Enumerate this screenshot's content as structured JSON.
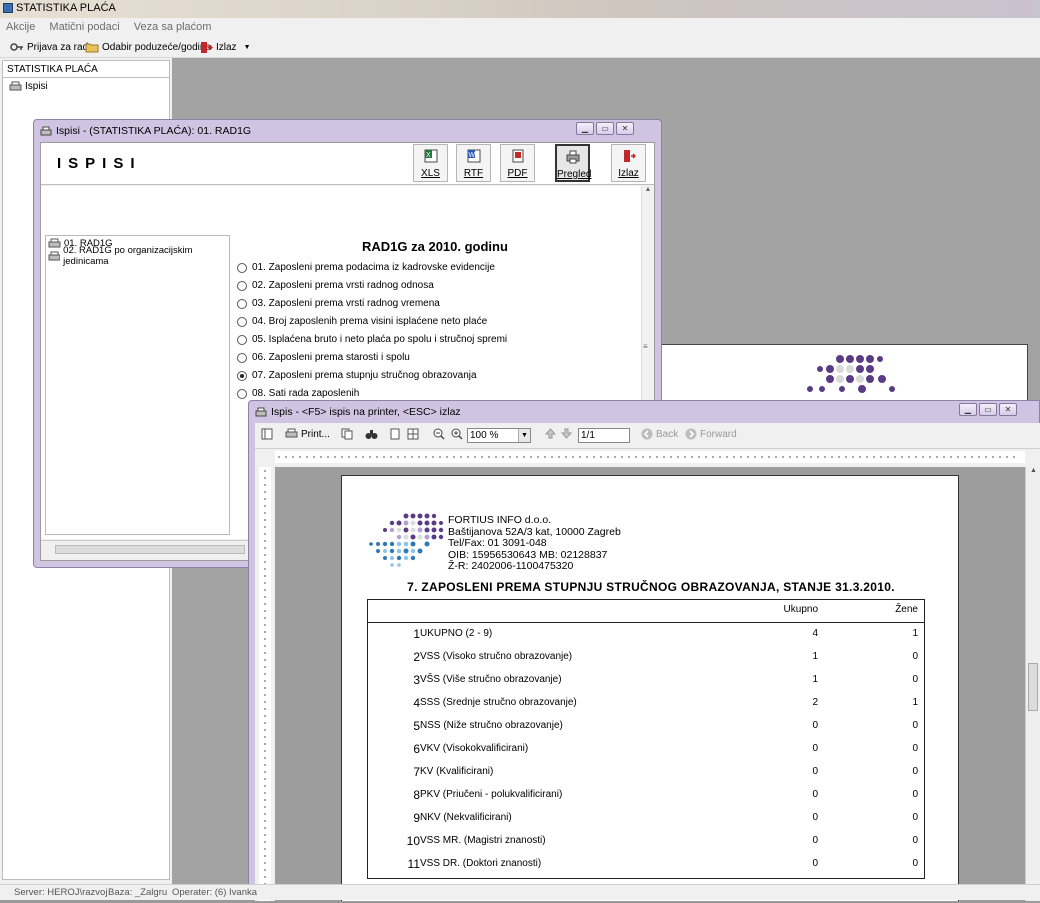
{
  "app": {
    "title": "STATISTIKA PLAĆA",
    "menu": [
      "Akcije",
      "Matični podaci",
      "Veza sa plaćom"
    ],
    "toolbar": {
      "login": "Prijava za rad",
      "company": "Odabir poduzeće/godina",
      "exit": "Izlaz"
    }
  },
  "left_panel": {
    "header": "STATISTIKA PLAĆA",
    "item": "Ispisi"
  },
  "statusbar": {
    "server": "Server: HEROJ\\razvoj",
    "baza": "Baza: _Zalgru",
    "operater": "Operater: (6) Ivanka"
  },
  "ispisi_window": {
    "title": "Ispisi - (STATISTIKA PLAĆA): 01. RAD1G",
    "heading": "ISPISI",
    "buttons": [
      "XLS",
      "RTF",
      "PDF",
      "Pregled",
      "Izlaz"
    ],
    "reports": [
      "01. RAD1G",
      "02. RAD1G po organizacijskim jedinicama"
    ],
    "section_title": "RAD1G za 2010. godinu",
    "options": [
      "01. Zaposleni prema podacima iz kadrovske evidencije",
      "02. Zaposleni prema vrsti radnog odnosa",
      "03. Zaposleni prema vrsti radnog vremena",
      "04. Broj zaposlenih prema visini isplaćene neto plaće",
      "05. Isplaćena bruto i neto plaća po spolu i stručnoj spremi",
      "06. Zaposleni prema starosti i spolu",
      "07. Zaposleni prema stupnju stručnog obrazovanja",
      "08. Sati rada zaposlenih"
    ],
    "selected_option_index": 6
  },
  "preview_window": {
    "title": "Ispis - <F5> ispis na printer, <ESC> izlaz",
    "print_label": "Print...",
    "zoom": "100 %",
    "page": "1/1",
    "back": "Back",
    "forward": "Forward",
    "company": {
      "name": "FORTIUS INFO d.o.o.",
      "address": "Baštijanova 52A/3 kat, 10000 Zagreb",
      "telfax": "Tel/Fax: 01 3091-048",
      "oib": "OIB: 15956530643  MB: 02128837",
      "zr": "Ž-R: 2402006-1100475320"
    },
    "report_title": "7. ZAPOSLENI PREMA STUPNJU STRUČNOG OBRAZOVANJA, STANJE 31.3.2010.",
    "table": {
      "col_ukupno": "Ukupno",
      "col_zene": "Žene",
      "rows": [
        {
          "num": "1",
          "name": "UKUPNO (2 - 9)",
          "ukupno": "4",
          "zene": "1"
        },
        {
          "num": "2",
          "name": "VSS (Visoko stručno obrazovanje)",
          "ukupno": "1",
          "zene": "0"
        },
        {
          "num": "3",
          "name": "VŠS (Više stručno obrazovanje)",
          "ukupno": "1",
          "zene": "0"
        },
        {
          "num": "4",
          "name": "SSS (Srednje stručno obrazovanje)",
          "ukupno": "2",
          "zene": "1"
        },
        {
          "num": "5",
          "name": "NSS (Niže stručno obrazovanje)",
          "ukupno": "0",
          "zene": "0"
        },
        {
          "num": "6",
          "name": "VKV (Visokokvalificirani)",
          "ukupno": "0",
          "zene": "0"
        },
        {
          "num": "7",
          "name": "KV (Kvalificirani)",
          "ukupno": "0",
          "zene": "0"
        },
        {
          "num": "8",
          "name": "PKV (Priučeni - polukvalificirani)",
          "ukupno": "0",
          "zene": "0"
        },
        {
          "num": "9",
          "name": "NKV (Nekvalificirani)",
          "ukupno": "0",
          "zene": "0"
        },
        {
          "num": "10",
          "name": "VSS MR. (Magistri znanosti)",
          "ukupno": "0",
          "zene": "0"
        },
        {
          "num": "11",
          "name": "VSS DR. (Doktori znanosti)",
          "ukupno": "0",
          "zene": "0"
        }
      ]
    }
  }
}
